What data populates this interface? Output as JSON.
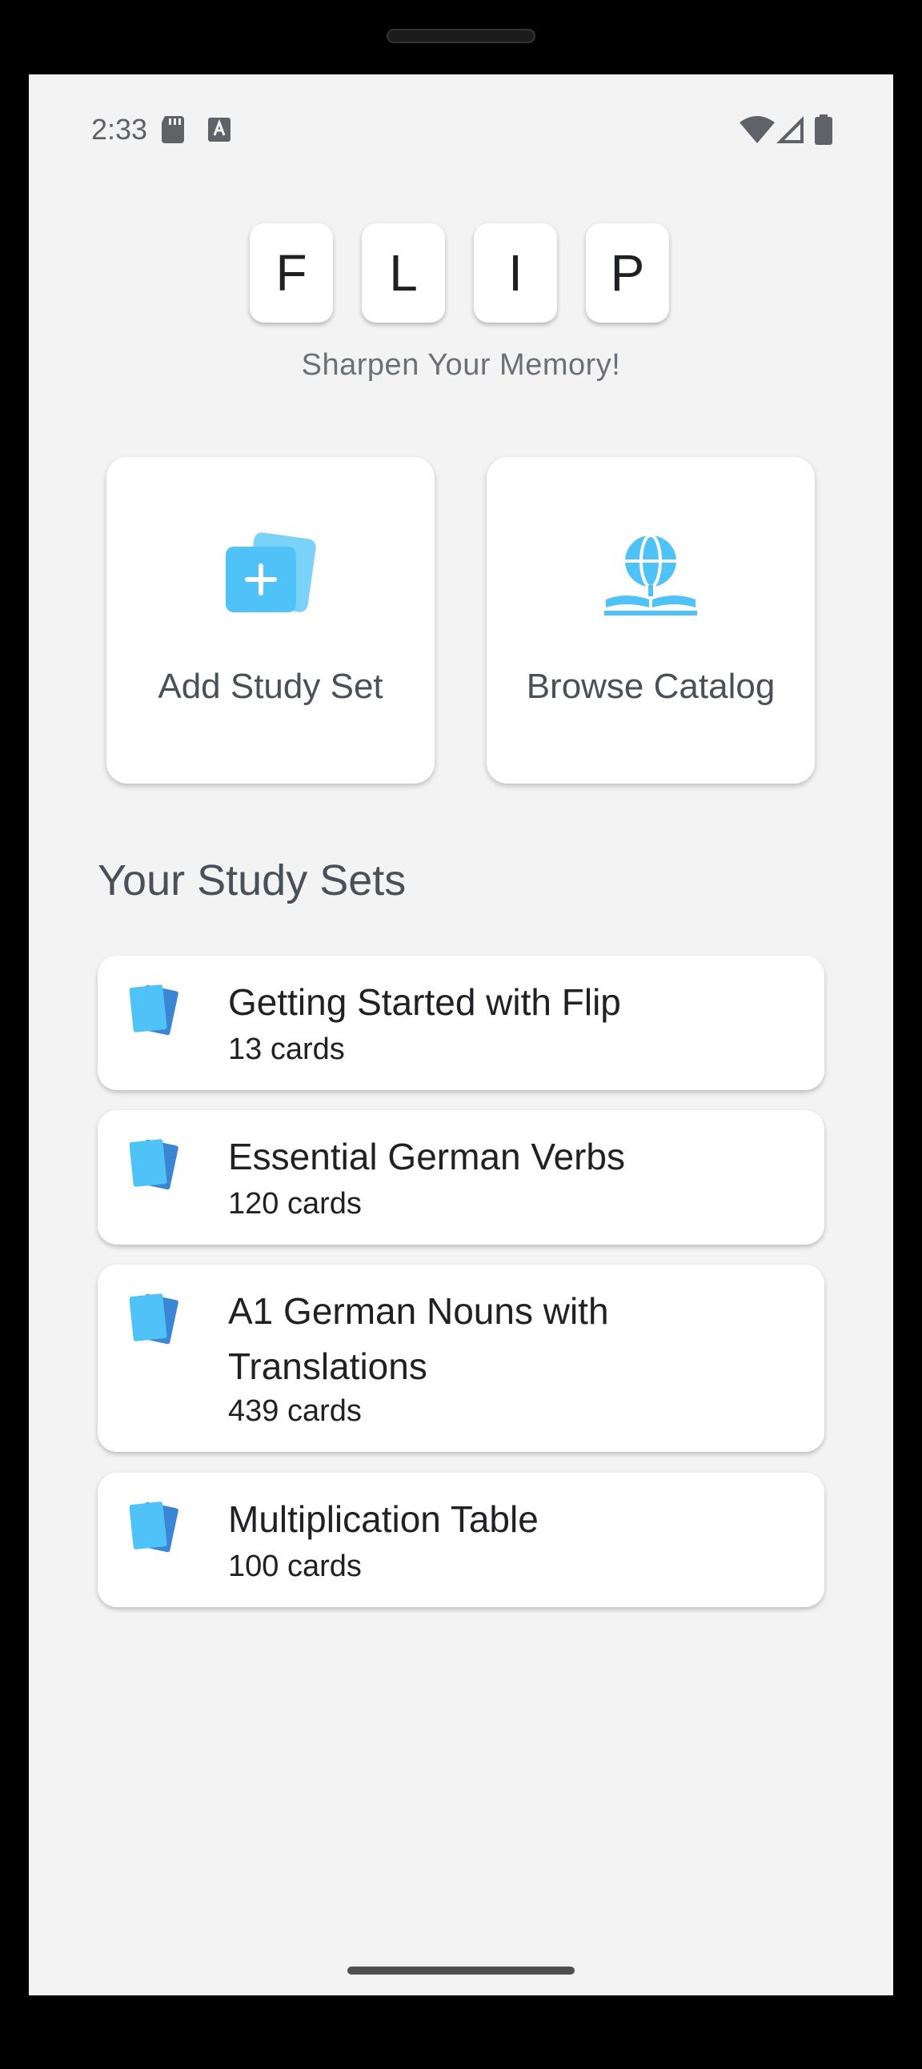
{
  "status_bar": {
    "time": "2:33"
  },
  "logo": {
    "letters": [
      "F",
      "L",
      "I",
      "P"
    ],
    "tagline": "Sharpen Your Memory!"
  },
  "actions": {
    "add": {
      "label": "Add Study Set",
      "icon": "add-cards-icon"
    },
    "browse": {
      "label": "Browse Catalog",
      "icon": "globe-book-icon"
    }
  },
  "section": {
    "title": "Your Study Sets"
  },
  "study_sets": [
    {
      "title": "Getting Started with Flip",
      "count": "13 cards"
    },
    {
      "title": "Essential German Verbs",
      "count": "120 cards"
    },
    {
      "title": "A1 German Nouns with Translations",
      "count": "439 cards"
    },
    {
      "title": "Multiplication Table",
      "count": "100 cards"
    }
  ],
  "colors": {
    "accent": "#4fc3f7",
    "accent_dark": "#3a86d4",
    "background": "#f3f3f3"
  }
}
